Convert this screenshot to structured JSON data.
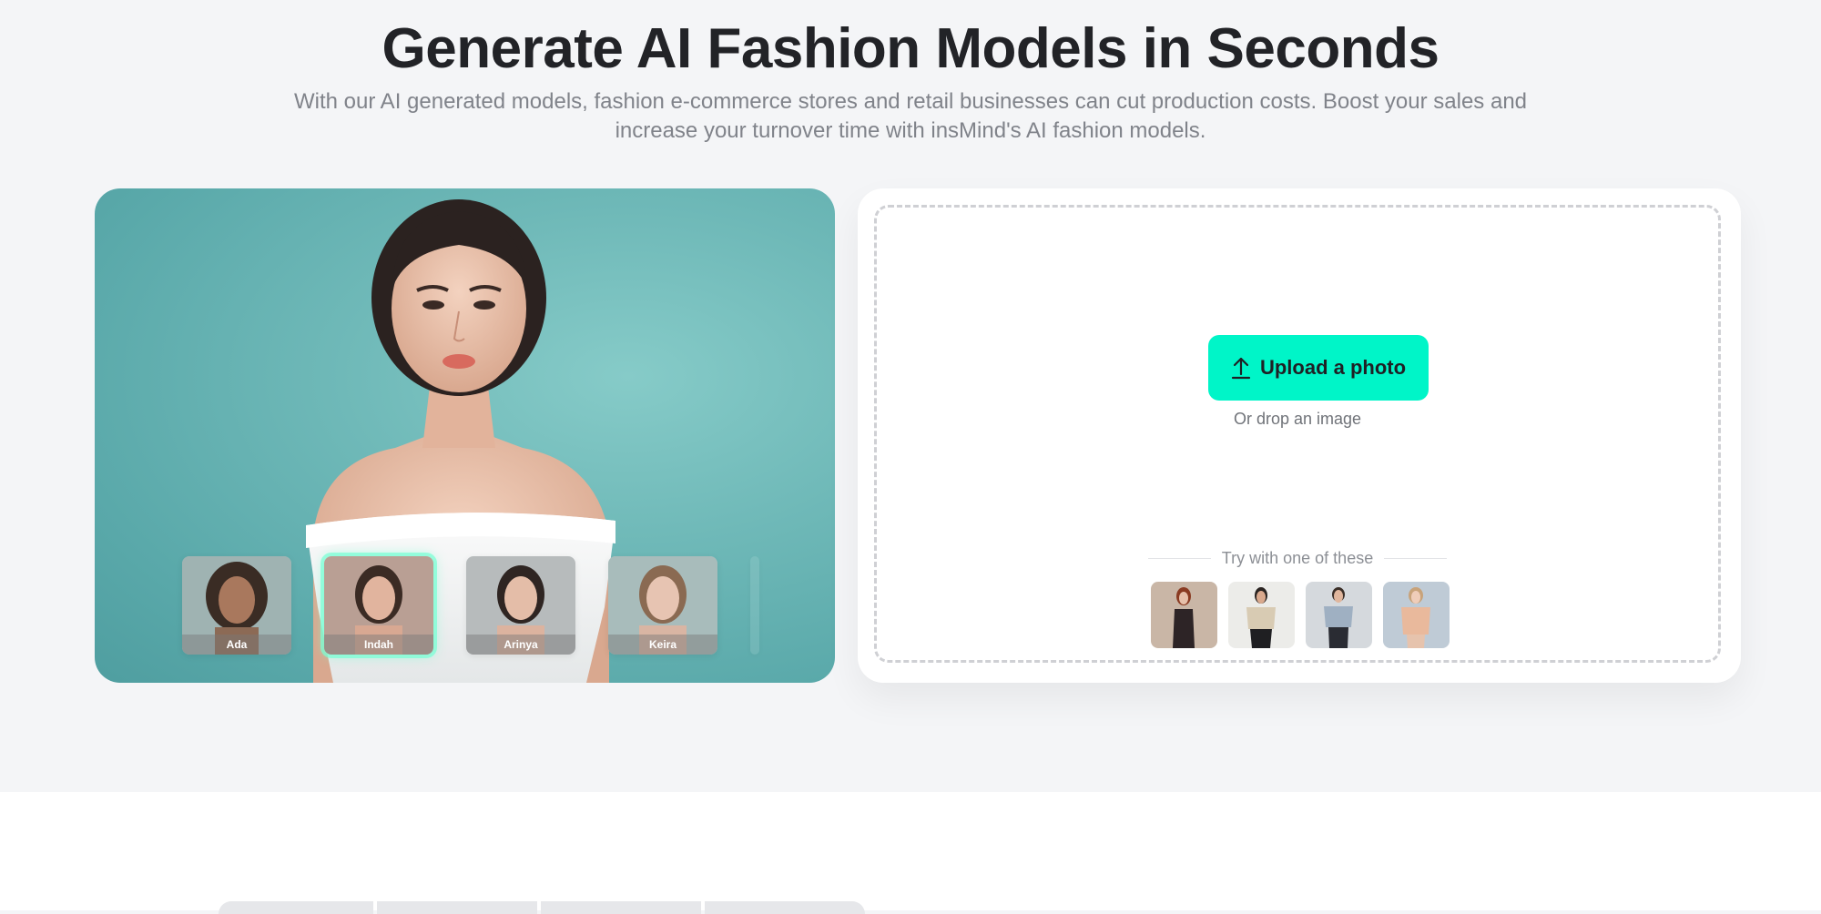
{
  "hero": {
    "title": "Generate AI Fashion Models in Seconds",
    "subtitle_line1": "With our AI generated models, fashion e-commerce stores and retail businesses can cut production costs. Boost your sales and",
    "subtitle_line2": "increase your turnover time with insMind's AI fashion models."
  },
  "showcase": {
    "models": [
      {
        "name": "Ada",
        "active": false
      },
      {
        "name": "Indah",
        "active": true
      },
      {
        "name": "Arinya",
        "active": false
      },
      {
        "name": "Keira",
        "active": false
      }
    ]
  },
  "upload": {
    "button_label": "Upload a photo",
    "button_icon": "upload-arrow-icon",
    "drop_hint": "Or drop an image",
    "samples_heading": "Try with one of these"
  },
  "colors": {
    "accent": "#00f5c8",
    "page_bg": "#f4f5f7",
    "title": "#222327",
    "subtitle": "#80838a",
    "showcase_bg": "#6fb9b8"
  }
}
